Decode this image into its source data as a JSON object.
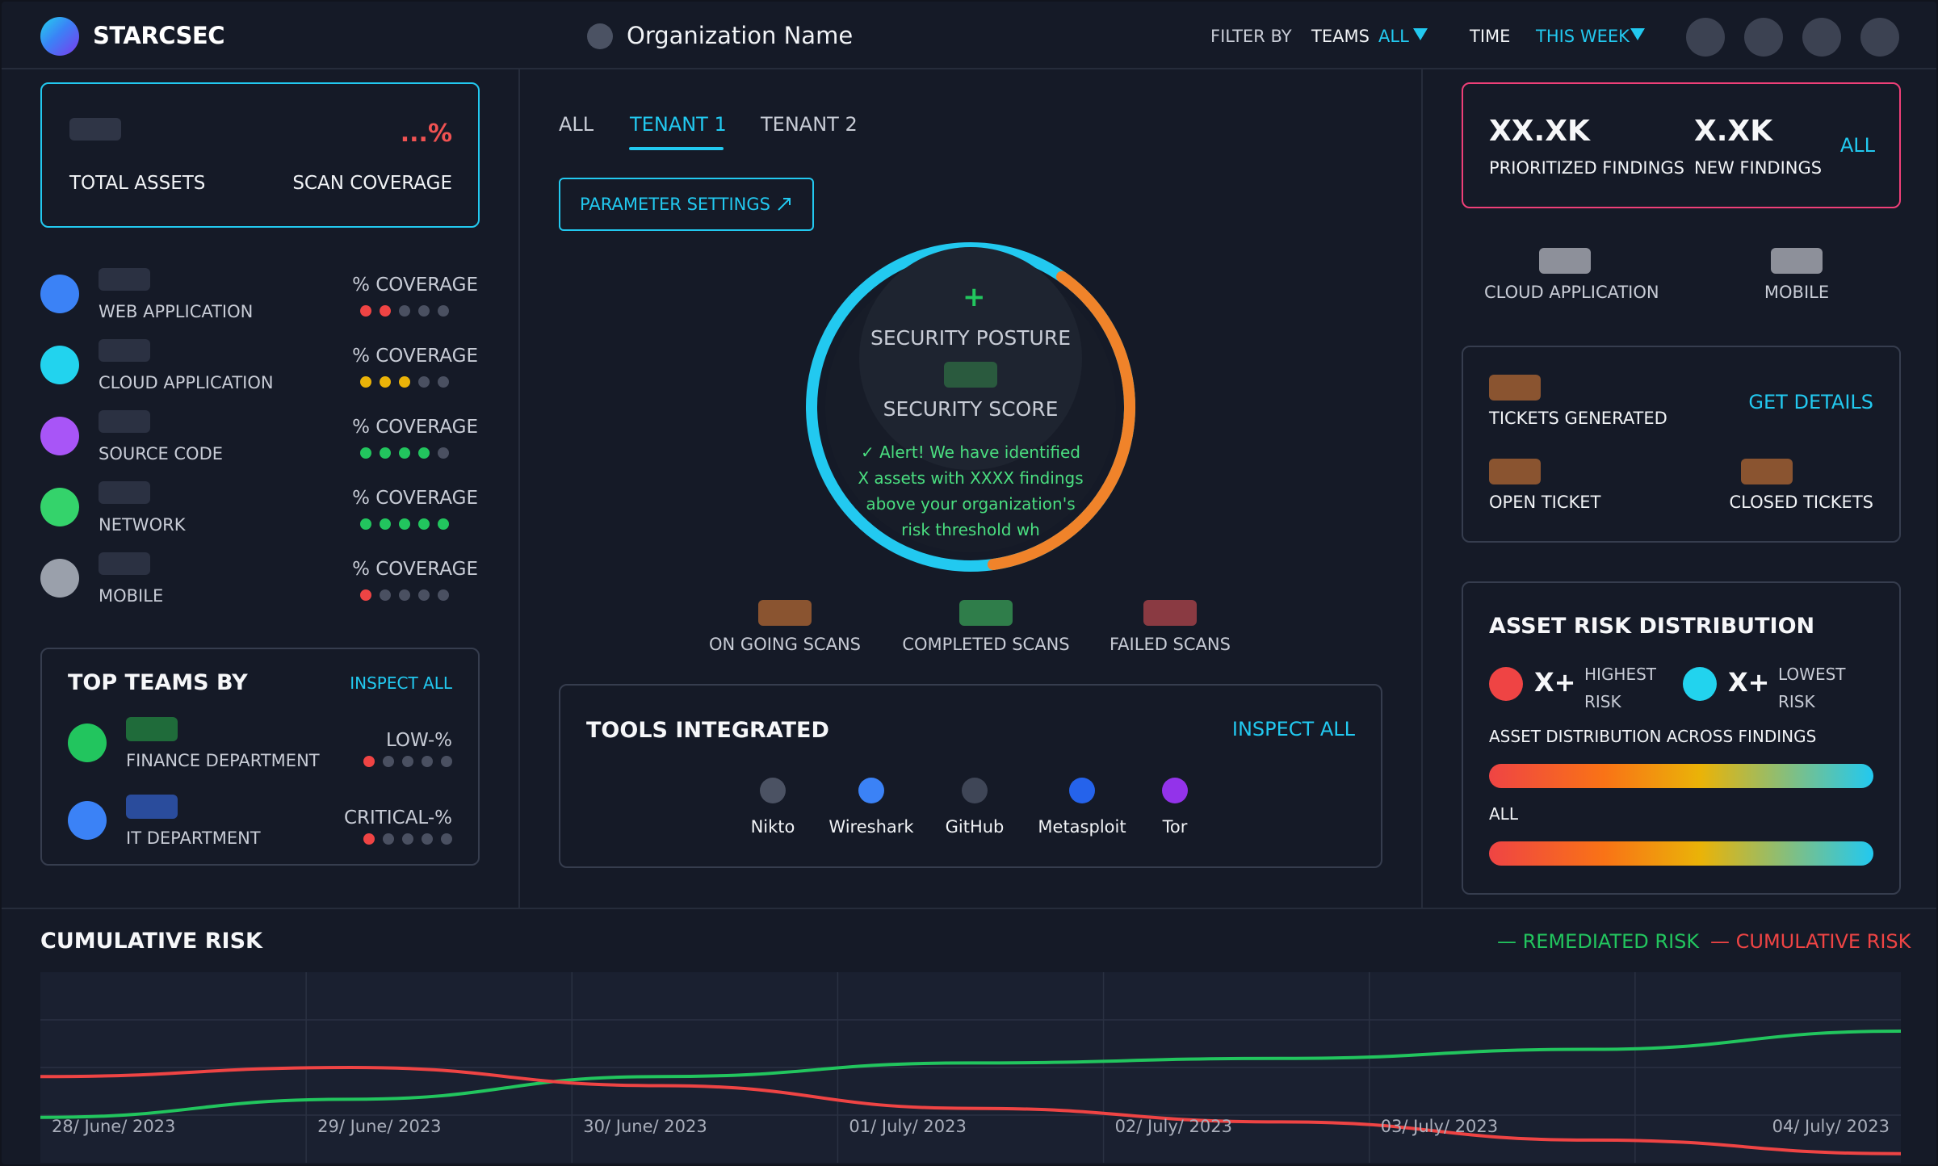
{
  "header": {
    "brand": "STARCSEC",
    "org_name": "Organization Name",
    "filter_by": "FILTER BY",
    "teams_label": "TEAMS",
    "teams_value": "ALL",
    "time_label": "TIME",
    "time_value": "THIS WEEK"
  },
  "assets_card": {
    "coverage_value": "...%",
    "total_assets": "TOTAL ASSETS",
    "scan_coverage": "SCAN COVERAGE"
  },
  "categories": [
    {
      "label": "WEB APPLICATION",
      "coverage": "% COVERAGE",
      "color": "#3b82f6",
      "dot_colors": [
        "#ef4444",
        "#ef4444",
        "#4a5061",
        "#4a5061",
        "#4a5061"
      ]
    },
    {
      "label": "CLOUD APPLICATION",
      "coverage": "% COVERAGE",
      "color": "#22d3ee",
      "dot_colors": [
        "#eab308",
        "#eab308",
        "#eab308",
        "#4a5061",
        "#4a5061"
      ]
    },
    {
      "label": "SOURCE CODE",
      "coverage": "% COVERAGE",
      "color": "#a855f7",
      "dot_colors": [
        "#22c55e",
        "#22c55e",
        "#22c55e",
        "#22c55e",
        "#4a5061"
      ]
    },
    {
      "label": "NETWORK",
      "coverage": "% COVERAGE",
      "color": "#34d36b",
      "dot_colors": [
        "#22c55e",
        "#22c55e",
        "#22c55e",
        "#22c55e",
        "#22c55e"
      ]
    },
    {
      "label": "MOBILE",
      "coverage": "% COVERAGE",
      "color": "#9aa0ab",
      "dot_colors": [
        "#ef4444",
        "#4a5061",
        "#4a5061",
        "#4a5061",
        "#4a5061"
      ]
    }
  ],
  "top_teams": {
    "title": "TOP TEAMS BY",
    "inspect": "INSPECT ALL",
    "teams": [
      {
        "name": "FINANCE DEPARTMENT",
        "level": "LOW-%",
        "color": "#22c55e",
        "dot_colors": [
          "#ef4444",
          "#4a5061",
          "#4a5061",
          "#4a5061",
          "#4a5061"
        ]
      },
      {
        "name": "IT DEPARTMENT",
        "level": "CRITICAL-%",
        "color": "#3b82f6",
        "dot_colors": [
          "#ef4444",
          "#4a5061",
          "#4a5061",
          "#4a5061",
          "#4a5061"
        ]
      }
    ]
  },
  "tabs": [
    "ALL",
    "TENANT 1",
    "TENANT 2"
  ],
  "active_tab": "TENANT 1",
  "param_button": "PARAMETER SETTINGS",
  "posture": {
    "plus": "+",
    "title": "SECURITY POSTURE",
    "score_label": "SECURITY SCORE",
    "alert_lines": [
      "✓ Alert! We have identified",
      "X assets with XXXX findings",
      "above your organization's",
      "risk threshold wh"
    ],
    "ring_fraction": 0.38
  },
  "scans": [
    {
      "label": "ON GOING SCANS",
      "color": "#8a5430"
    },
    {
      "label": "COMPLETED SCANS",
      "color": "#2f7d4a"
    },
    {
      "label": "FAILED SCANS",
      "color": "#8a3a42"
    }
  ],
  "tools": {
    "title": "TOOLS INTEGRATED",
    "inspect": "INSPECT ALL",
    "items": [
      {
        "name": "Nikto",
        "color": "#4b5263"
      },
      {
        "name": "Wireshark",
        "color": "#3b82f6"
      },
      {
        "name": "GitHub",
        "color": "#3f4657"
      },
      {
        "name": "Metasploit",
        "color": "#2563eb"
      },
      {
        "name": "Tor",
        "color": "#9333ea"
      }
    ]
  },
  "findings": {
    "prioritized_value": "XX.XK",
    "prioritized_label": "PRIORITIZED FINDINGS",
    "new_value": "X.XK",
    "new_label": "NEW FINDINGS",
    "all": "ALL"
  },
  "platforms": [
    "CLOUD APPLICATION",
    "MOBILE"
  ],
  "tickets": {
    "generated": "TICKETS GENERATED",
    "get_details": "GET DETAILS",
    "open": "OPEN TICKET",
    "closed": "CLOSED TICKETS"
  },
  "risk_distribution": {
    "title": "ASSET RISK DISTRIBUTION",
    "high_value": "X+",
    "high_label_1": "HIGHEST",
    "high_label_2": "RISK",
    "low_value": "X+",
    "low_label_1": "LOWEST",
    "low_label_2": "RISK",
    "across": "ASSET DISTRIBUTION ACROSS FINDINGS",
    "all": "ALL"
  },
  "cumulative": {
    "title": "CUMULATIVE RISK",
    "legend_remediated": "— REMEDIATED RISK",
    "legend_cumulative": "— CUMULATIVE RISK",
    "remediated_color": "#22c55e",
    "cumulative_color": "#ef4444"
  },
  "chart_data": {
    "type": "line",
    "title": "CUMULATIVE RISK",
    "x": [
      "28/ June/ 2023",
      "29/ June/ 2023",
      "30/ June/ 2023",
      "01/ July/ 2023",
      "02/ July/ 2023",
      "03/ July/ 2023",
      "04/ July/ 2023"
    ],
    "series": [
      {
        "name": "REMEDIATED RISK",
        "values": [
          0.4,
          0.8,
          1.3,
          1.6,
          1.7,
          1.9,
          2.3
        ]
      },
      {
        "name": "CUMULATIVE RISK",
        "values": [
          1.3,
          1.5,
          1.1,
          0.6,
          0.3,
          -0.1,
          -0.4
        ]
      }
    ],
    "ylim": [
      -0.6,
      3.6
    ],
    "grid": true,
    "legend": "top-right"
  }
}
